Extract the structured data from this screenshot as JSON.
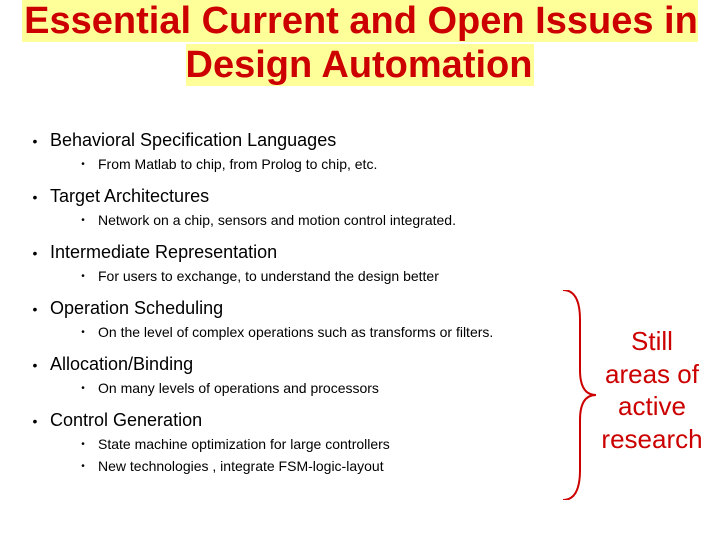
{
  "title": "Essential Current and Open Issues in Design Automation",
  "items": [
    {
      "label": "Behavioral Specification Languages",
      "subs": [
        "From Matlab to chip, from Prolog to chip, etc."
      ]
    },
    {
      "label": "Target Architectures",
      "subs": [
        "Network on a chip, sensors and motion control integrated."
      ]
    },
    {
      "label": "Intermediate Representation",
      "subs": [
        "For users to exchange, to understand the design better"
      ]
    },
    {
      "label": "Operation Scheduling",
      "subs": [
        "On the level of complex operations such as transforms or filters."
      ]
    },
    {
      "label": "Allocation/Binding",
      "subs": [
        "On many levels of operations and processors"
      ]
    },
    {
      "label": "Control Generation",
      "subs": [
        "State machine optimization for large controllers",
        "New technologies , integrate FSM-logic-layout"
      ]
    }
  ],
  "callout": "Still areas of active research"
}
